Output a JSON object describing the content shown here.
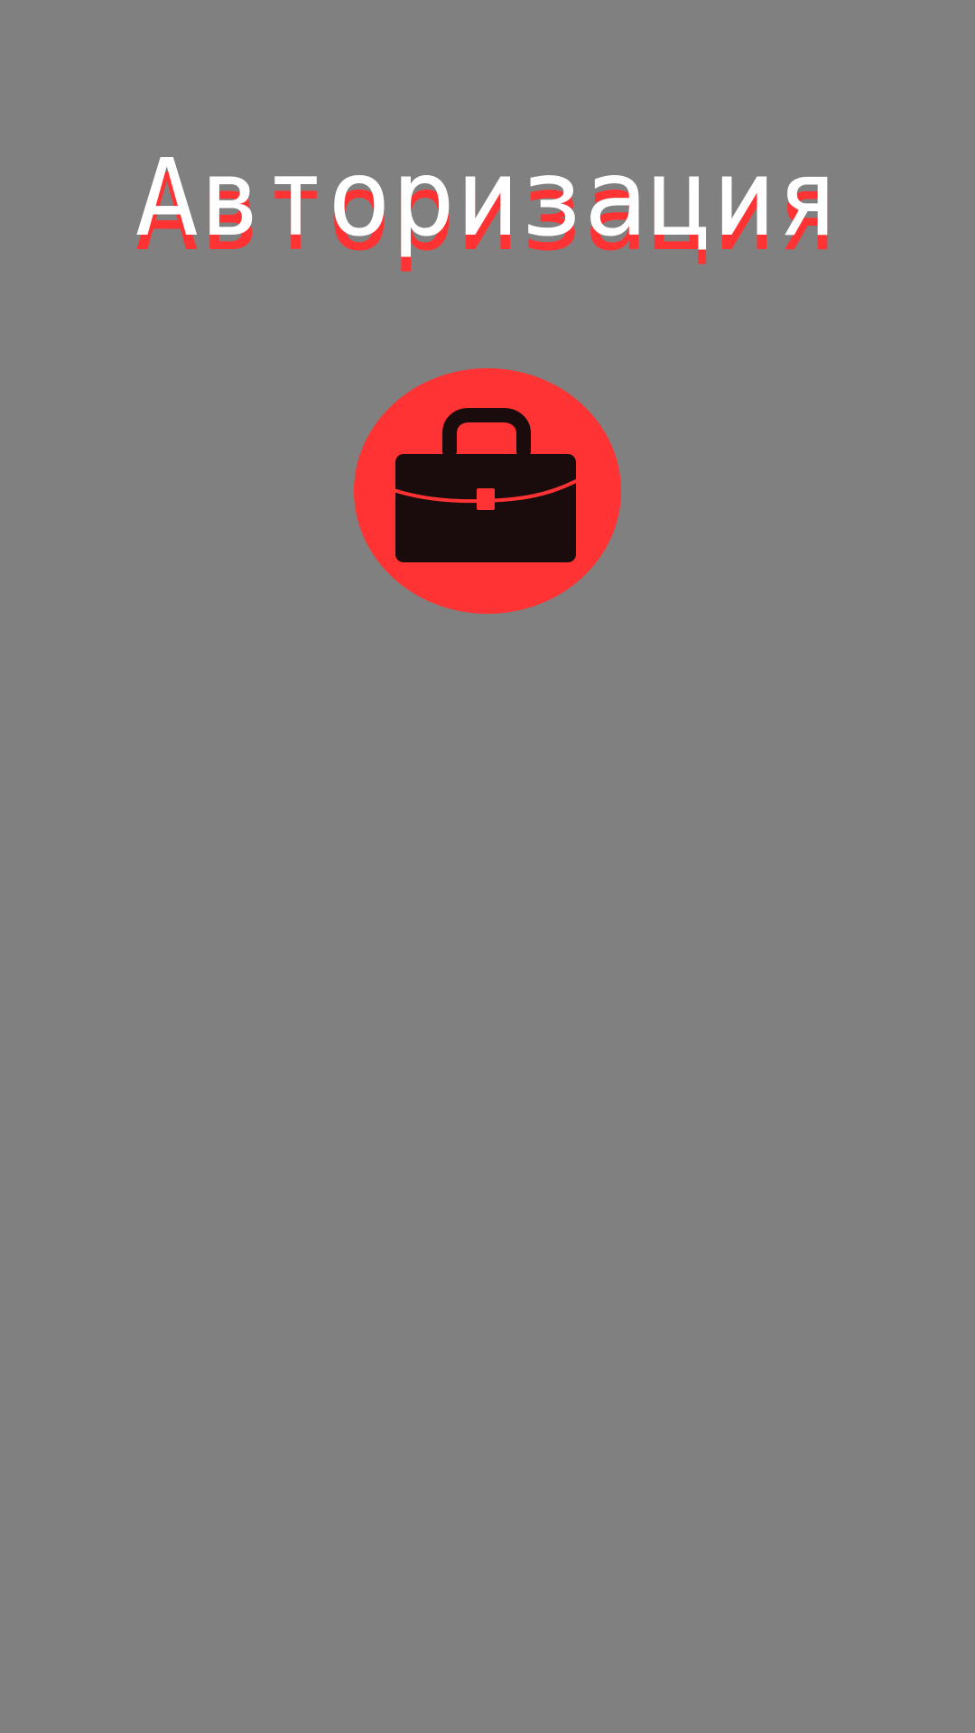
{
  "screen": {
    "title": "Авторизация",
    "background_color": "#808080"
  },
  "logo": {
    "icon": "briefcase-icon",
    "circle_color": "#ff3333",
    "briefcase_color": "#1a0c0c"
  },
  "colors": {
    "title_text": "#ffffff",
    "title_shadow": "#ff3333"
  }
}
